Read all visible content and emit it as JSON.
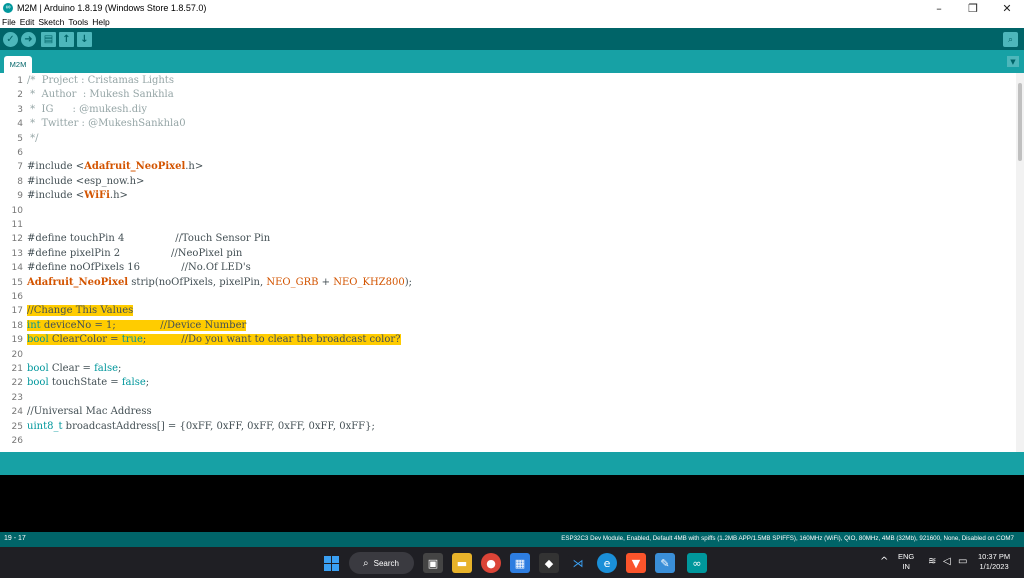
{
  "window": {
    "title": "M2M | Arduino 1.8.19 (Windows Store 1.8.57.0)",
    "minimize_icon": "minimize-icon",
    "maximize_icon": "restore-icon",
    "close_icon": "close-icon"
  },
  "menu": [
    "File",
    "Edit",
    "Sketch",
    "Tools",
    "Help"
  ],
  "toolbar": {
    "buttons": [
      "verify-icon",
      "upload-icon",
      "new-icon",
      "open-icon",
      "save-icon"
    ],
    "serial_monitor": "serial-monitor-icon"
  },
  "tabs": [
    {
      "label": "M2M"
    }
  ],
  "editor": {
    "lines": [
      [
        {
          "t": "/*  Project : Cristamas Lights",
          "c": "comment"
        }
      ],
      [
        {
          "t": " *  Author  : Mukesh Sankhla",
          "c": "comment"
        }
      ],
      [
        {
          "t": " *  IG      : @mukesh.diy",
          "c": "comment"
        }
      ],
      [
        {
          "t": " *  Twitter : @MukeshSankhla0",
          "c": "comment"
        }
      ],
      [
        {
          "t": " */",
          "c": "comment"
        }
      ],
      [],
      [
        {
          "t": "#include <",
          "c": ""
        },
        {
          "t": "Adafruit_NeoPixel",
          "c": "lib"
        },
        {
          "t": ".h>",
          "c": ""
        }
      ],
      [
        {
          "t": "#include <esp_now.h>",
          "c": ""
        }
      ],
      [
        {
          "t": "#include <",
          "c": ""
        },
        {
          "t": "WiFi",
          "c": "lib"
        },
        {
          "t": ".h>",
          "c": ""
        }
      ],
      [],
      [],
      [
        {
          "t": "#define touchPin 4                //Touch Sensor Pin",
          "c": ""
        }
      ],
      [
        {
          "t": "#define pixelPin 2                //NeoPixel pin",
          "c": ""
        }
      ],
      [
        {
          "t": "#define noOfPixels 16             //No.Of LED's",
          "c": ""
        }
      ],
      [
        {
          "t": "Adafruit_NeoPixel",
          "c": "lib"
        },
        {
          "t": " strip(noOfPixels, pixelPin, ",
          "c": ""
        },
        {
          "t": "NEO_GRB",
          "c": "const"
        },
        {
          "t": " + ",
          "c": ""
        },
        {
          "t": "NEO_KHZ800",
          "c": "const"
        },
        {
          "t": ");",
          "c": ""
        }
      ],
      [],
      [
        {
          "t": "//Change This Values",
          "c": "hl"
        }
      ],
      [
        {
          "t": "int",
          "c": "kw hl"
        },
        {
          "t": " deviceNo = 1;              //Device Number",
          "c": "hl"
        }
      ],
      [
        {
          "t": "bool",
          "c": "kw hl"
        },
        {
          "t": " ClearColor = ",
          "c": "hl"
        },
        {
          "t": "true",
          "c": "kw hl"
        },
        {
          "t": ";           //Do you want to clear the broadcast color?",
          "c": "hl"
        }
      ],
      [],
      [
        {
          "t": "bool",
          "c": "kw"
        },
        {
          "t": " Clear = ",
          "c": ""
        },
        {
          "t": "false",
          "c": "kw"
        },
        {
          "t": ";",
          "c": ""
        }
      ],
      [
        {
          "t": "bool",
          "c": "kw"
        },
        {
          "t": " touchState = ",
          "c": ""
        },
        {
          "t": "false",
          "c": "kw"
        },
        {
          "t": ";",
          "c": ""
        }
      ],
      [],
      [
        {
          "t": "//Universal Mac Address",
          "c": ""
        }
      ],
      [
        {
          "t": "uint8_t",
          "c": "kw"
        },
        {
          "t": " broadcastAddress[] = {0xFF, 0xFF, 0xFF, 0xFF, 0xFF, 0xFF};",
          "c": ""
        }
      ],
      []
    ]
  },
  "status": {
    "cursor_position": "19 - 17",
    "board_info": "ESP32C3 Dev Module, Enabled, Default 4MB with spiffs (1.2MB APP/1.5MB SPIFFS), 160MHz (WiFi), QIO, 80MHz, 4MB (32Mb), 921600, None, Disabled on COM7"
  },
  "taskbar": {
    "search_label": "Search",
    "apps": [
      "windows-start-icon",
      "task-view-icon",
      "file-explorer-icon",
      "chrome-icon",
      "store-icon",
      "game-icon",
      "vscode-icon",
      "edge-icon",
      "brave-icon",
      "paint-icon",
      "arduino-icon"
    ],
    "language": "ENG",
    "region": "IN",
    "time": "10:37 PM",
    "date": "1/1/2023"
  },
  "colors": {
    "teal_dark": "#006468",
    "teal": "#17a1a5",
    "teal_light": "#4db7bb",
    "highlight": "#ffcc00",
    "keyword": "#00979c",
    "library": "#d35400",
    "comment": "#95a5a6"
  }
}
